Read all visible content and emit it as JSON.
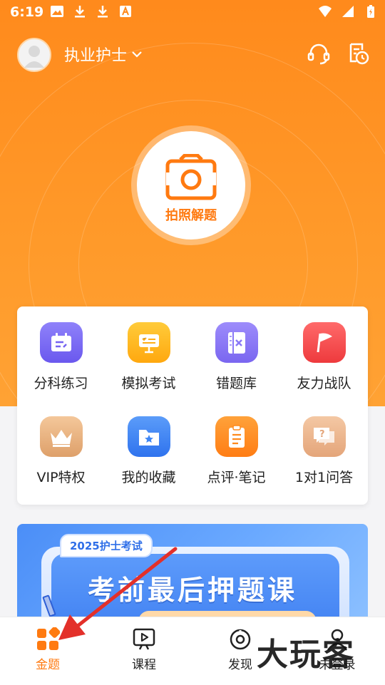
{
  "status": {
    "time": "6:19"
  },
  "header": {
    "title": "执业护士"
  },
  "camera": {
    "label": "拍照解题"
  },
  "grid": {
    "items": [
      {
        "label": "分科练习",
        "icon": "calendar-check-icon",
        "color": "#7c6cf5"
      },
      {
        "label": "模拟考试",
        "icon": "exam-board-icon",
        "color": "#ffb51e"
      },
      {
        "label": "错题库",
        "icon": "wrong-book-icon",
        "color": "#8a78f7"
      },
      {
        "label": "友力战队",
        "icon": "flag-icon",
        "color": "#f5494c"
      },
      {
        "label": "VIP特权",
        "icon": "crown-icon",
        "color": "#e8b07a"
      },
      {
        "label": "我的收藏",
        "icon": "favorite-folder-icon",
        "color": "#3f86f5"
      },
      {
        "label": "点评·笔记",
        "icon": "notes-icon",
        "color": "#ff8a1c"
      },
      {
        "label": "1对1问答",
        "icon": "question-chat-icon",
        "color": "#e9b38a"
      }
    ]
  },
  "banner": {
    "tag": "2025护士考试",
    "title": "考前最后押题课"
  },
  "tabs": [
    {
      "label": "金题",
      "icon": "grid-diamond-icon",
      "active": true
    },
    {
      "label": "课程",
      "icon": "play-board-icon",
      "active": false
    },
    {
      "label": "发现",
      "icon": "discover-icon",
      "active": false
    },
    {
      "label": "未登录",
      "icon": "user-icon",
      "active": false
    }
  ],
  "watermark": {
    "text": "大玩客"
  },
  "colors": {
    "brand": "#ff8a1c",
    "accent": "#ff7a10"
  }
}
